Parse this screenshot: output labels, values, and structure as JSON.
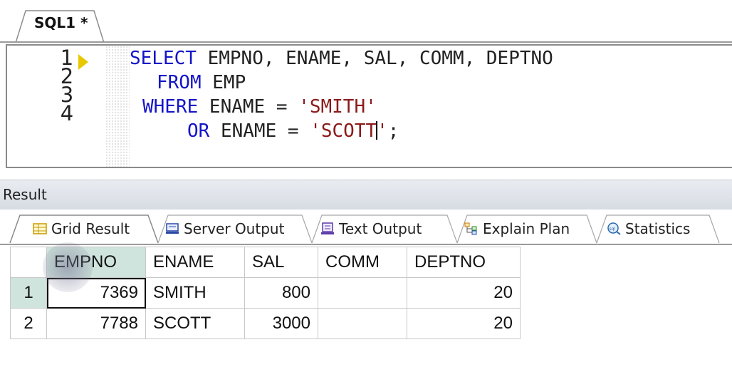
{
  "editor_tab": {
    "label": "SQL1 *"
  },
  "editor": {
    "line_numbers": [
      "1",
      "2",
      "3",
      "4"
    ],
    "lines": [
      {
        "kw": "SELECT",
        "rest": " EMPNO, ENAME, SAL, COMM, DEPTNO"
      },
      {
        "kw": "FROM",
        "rest": " EMP"
      },
      {
        "kw": "WHERE",
        "rest": " ENAME = ",
        "str": "'SMITH'"
      },
      {
        "kw": "OR",
        "rest": " ENAME = ",
        "str_a": "'SCOTT",
        "str_b": "'",
        "tail": ";"
      }
    ]
  },
  "result": {
    "label": "Result",
    "tabs": [
      "Grid Result",
      "Server Output",
      "Text Output",
      "Explain Plan",
      "Statistics"
    ]
  },
  "grid": {
    "columns": [
      "EMPNO",
      "ENAME",
      "SAL",
      "COMM",
      "DEPTNO"
    ],
    "rows": [
      {
        "row_no": "1",
        "EMPNO": "7369",
        "ENAME": "SMITH",
        "SAL": "800",
        "COMM": "",
        "DEPTNO": "20"
      },
      {
        "row_no": "2",
        "EMPNO": "7788",
        "ENAME": "SCOTT",
        "SAL": "3000",
        "COMM": "",
        "DEPTNO": "20"
      }
    ]
  },
  "colors": {
    "keyword": "#1414c8",
    "string": "#8b1a1a",
    "selection": "#cfe4dc",
    "marker": "#e8c900"
  },
  "icons": [
    "current-line-marker-icon",
    "grid-icon",
    "server-output-icon",
    "text-output-icon",
    "explain-plan-icon",
    "statistics-icon"
  ]
}
